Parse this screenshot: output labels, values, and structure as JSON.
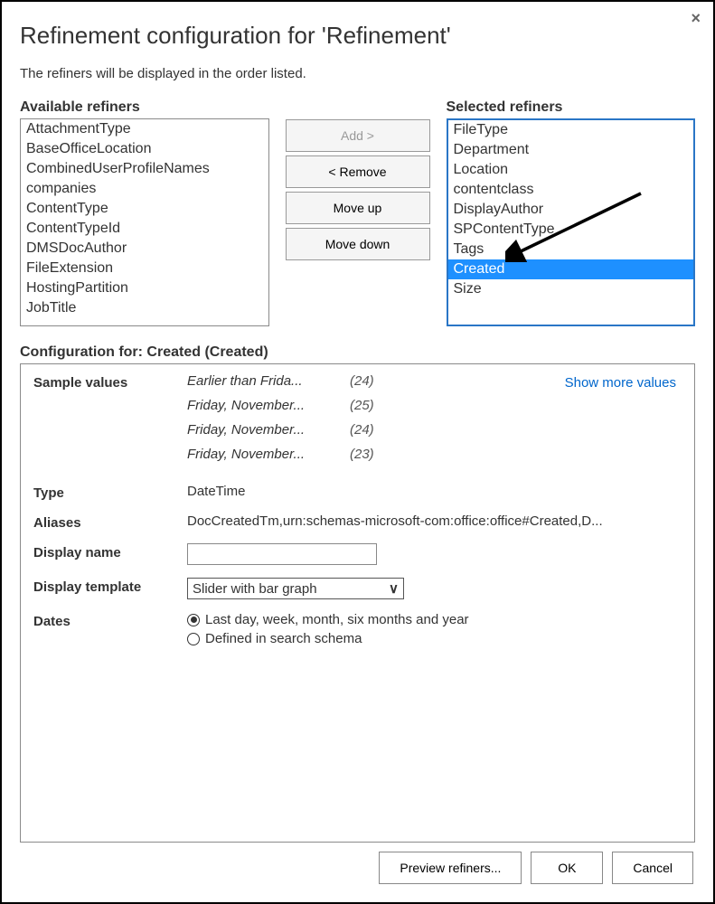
{
  "dialog": {
    "title": "Refinement configuration for 'Refinement'",
    "subtitle": "The refiners will be displayed in the order listed.",
    "close_label": "×"
  },
  "available": {
    "header": "Available refiners",
    "items": [
      "AttachmentType",
      "BaseOfficeLocation",
      "CombinedUserProfileNames",
      "companies",
      "ContentType",
      "ContentTypeId",
      "DMSDocAuthor",
      "FileExtension",
      "HostingPartition",
      "JobTitle"
    ]
  },
  "buttons": {
    "add": "Add >",
    "remove": "< Remove",
    "move_up": "Move up",
    "move_down": "Move down"
  },
  "selected": {
    "header": "Selected refiners",
    "items": [
      "FileType",
      "Department",
      "Location",
      "contentclass",
      "DisplayAuthor",
      "SPContentType",
      "Tags",
      "Created",
      "Size"
    ],
    "highlighted": "Created"
  },
  "config": {
    "header": "Configuration for: Created (Created)",
    "sample_label": "Sample values",
    "samples": [
      {
        "text": "Earlier than Frida...",
        "count": "(24)"
      },
      {
        "text": "Friday, November...",
        "count": "(25)"
      },
      {
        "text": "Friday, November...",
        "count": "(24)"
      },
      {
        "text": "Friday, November...",
        "count": "(23)"
      }
    ],
    "show_more": "Show more values",
    "type_label": "Type",
    "type_value": "DateTime",
    "aliases_label": "Aliases",
    "aliases_value": "DocCreatedTm,urn:schemas-microsoft-com:office:office#Created,D...",
    "display_name_label": "Display name",
    "display_name_value": "",
    "display_template_label": "Display template",
    "display_template_value": "Slider with bar graph",
    "dates_label": "Dates",
    "dates_option1": "Last day, week, month, six months and year",
    "dates_option2": "Defined in search schema",
    "dates_selected": "option1"
  },
  "footer": {
    "preview": "Preview refiners...",
    "ok": "OK",
    "cancel": "Cancel"
  }
}
